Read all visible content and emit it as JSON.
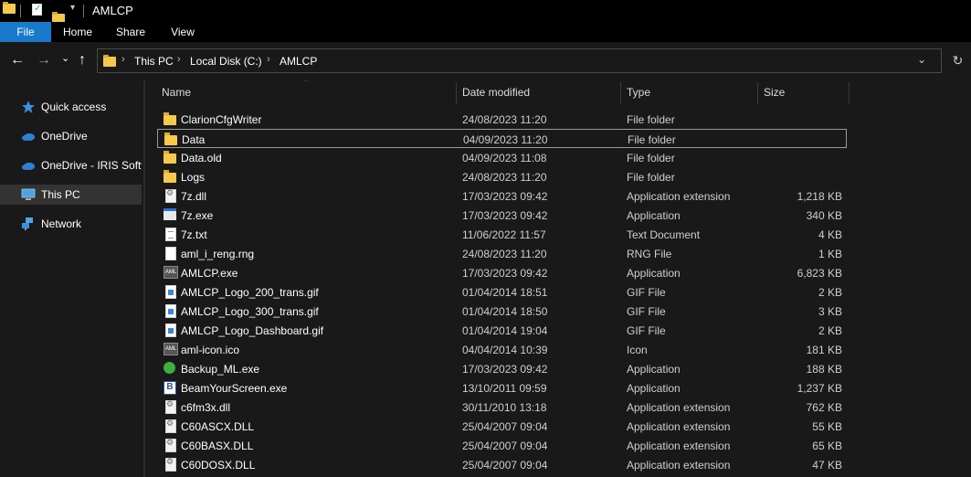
{
  "window": {
    "title": "AMLCP"
  },
  "ribbon": {
    "tabs": [
      "File",
      "Home",
      "Share",
      "View"
    ]
  },
  "address": {
    "crumbs": [
      "This PC",
      "Local Disk (C:)",
      "AMLCP"
    ],
    "separator": "›"
  },
  "nav": {
    "back": "←",
    "forward": "→",
    "recent": "⌄",
    "up": "↑",
    "dropdown": "⌄",
    "refresh": "↻"
  },
  "sidebar": {
    "items": [
      {
        "label": "Quick access",
        "icon": "star-icon"
      },
      {
        "label": "OneDrive",
        "icon": "cloud-icon"
      },
      {
        "label": "OneDrive - IRIS Software",
        "icon": "cloud-icon"
      },
      {
        "label": "This PC",
        "icon": "computer-icon"
      },
      {
        "label": "Network",
        "icon": "network-icon"
      }
    ]
  },
  "columns": {
    "name": "Name",
    "date": "Date modified",
    "type": "Type",
    "size": "Size"
  },
  "files": [
    {
      "name": "ClarionCfgWriter",
      "date": "24/08/2023 11:20",
      "type": "File folder",
      "size": "",
      "icon": "folder"
    },
    {
      "name": "Data",
      "date": "04/09/2023 11:20",
      "type": "File folder",
      "size": "",
      "icon": "folder"
    },
    {
      "name": "Data.old",
      "date": "04/09/2023 11:08",
      "type": "File folder",
      "size": "",
      "icon": "folder"
    },
    {
      "name": "Logs",
      "date": "24/08/2023 11:20",
      "type": "File folder",
      "size": "",
      "icon": "folder"
    },
    {
      "name": "7z.dll",
      "date": "17/03/2023 09:42",
      "type": "Application extension",
      "size": "1,218 KB",
      "icon": "dll"
    },
    {
      "name": "7z.exe",
      "date": "17/03/2023 09:42",
      "type": "Application",
      "size": "340 KB",
      "icon": "exe"
    },
    {
      "name": "7z.txt",
      "date": "11/06/2022 11:57",
      "type": "Text Document",
      "size": "4 KB",
      "icon": "txt"
    },
    {
      "name": "aml_i_reng.rng",
      "date": "24/08/2023 11:20",
      "type": "RNG File",
      "size": "1 KB",
      "icon": "blank"
    },
    {
      "name": "AMLCP.exe",
      "date": "17/03/2023 09:42",
      "type": "Application",
      "size": "6,823 KB",
      "icon": "aml"
    },
    {
      "name": "AMLCP_Logo_200_trans.gif",
      "date": "01/04/2014 18:51",
      "type": "GIF File",
      "size": "2 KB",
      "icon": "gif"
    },
    {
      "name": "AMLCP_Logo_300_trans.gif",
      "date": "01/04/2014 18:50",
      "type": "GIF File",
      "size": "3 KB",
      "icon": "gif"
    },
    {
      "name": "AMLCP_Logo_Dashboard.gif",
      "date": "01/04/2014 19:04",
      "type": "GIF File",
      "size": "2 KB",
      "icon": "gif"
    },
    {
      "name": "aml-icon.ico",
      "date": "04/04/2014 10:39",
      "type": "Icon",
      "size": "181 KB",
      "icon": "aml"
    },
    {
      "name": "Backup_ML.exe",
      "date": "17/03/2023 09:42",
      "type": "Application",
      "size": "188 KB",
      "icon": "backup"
    },
    {
      "name": "BeamYourScreen.exe",
      "date": "13/10/2011 09:59",
      "type": "Application",
      "size": "1,237 KB",
      "icon": "beam"
    },
    {
      "name": "c6fm3x.dll",
      "date": "30/11/2010 13:18",
      "type": "Application extension",
      "size": "762 KB",
      "icon": "dll"
    },
    {
      "name": "C60ASCX.DLL",
      "date": "25/04/2007 09:04",
      "type": "Application extension",
      "size": "55 KB",
      "icon": "dll"
    },
    {
      "name": "C60BASX.DLL",
      "date": "25/04/2007 09:04",
      "type": "Application extension",
      "size": "65 KB",
      "icon": "dll"
    },
    {
      "name": "C60DOSX.DLL",
      "date": "25/04/2007 09:04",
      "type": "Application extension",
      "size": "47 KB",
      "icon": "dll"
    }
  ],
  "focused_row": 1,
  "colors": {
    "file_tab": "#1979ca",
    "folder": "#f6c84c",
    "background": "#191919"
  }
}
